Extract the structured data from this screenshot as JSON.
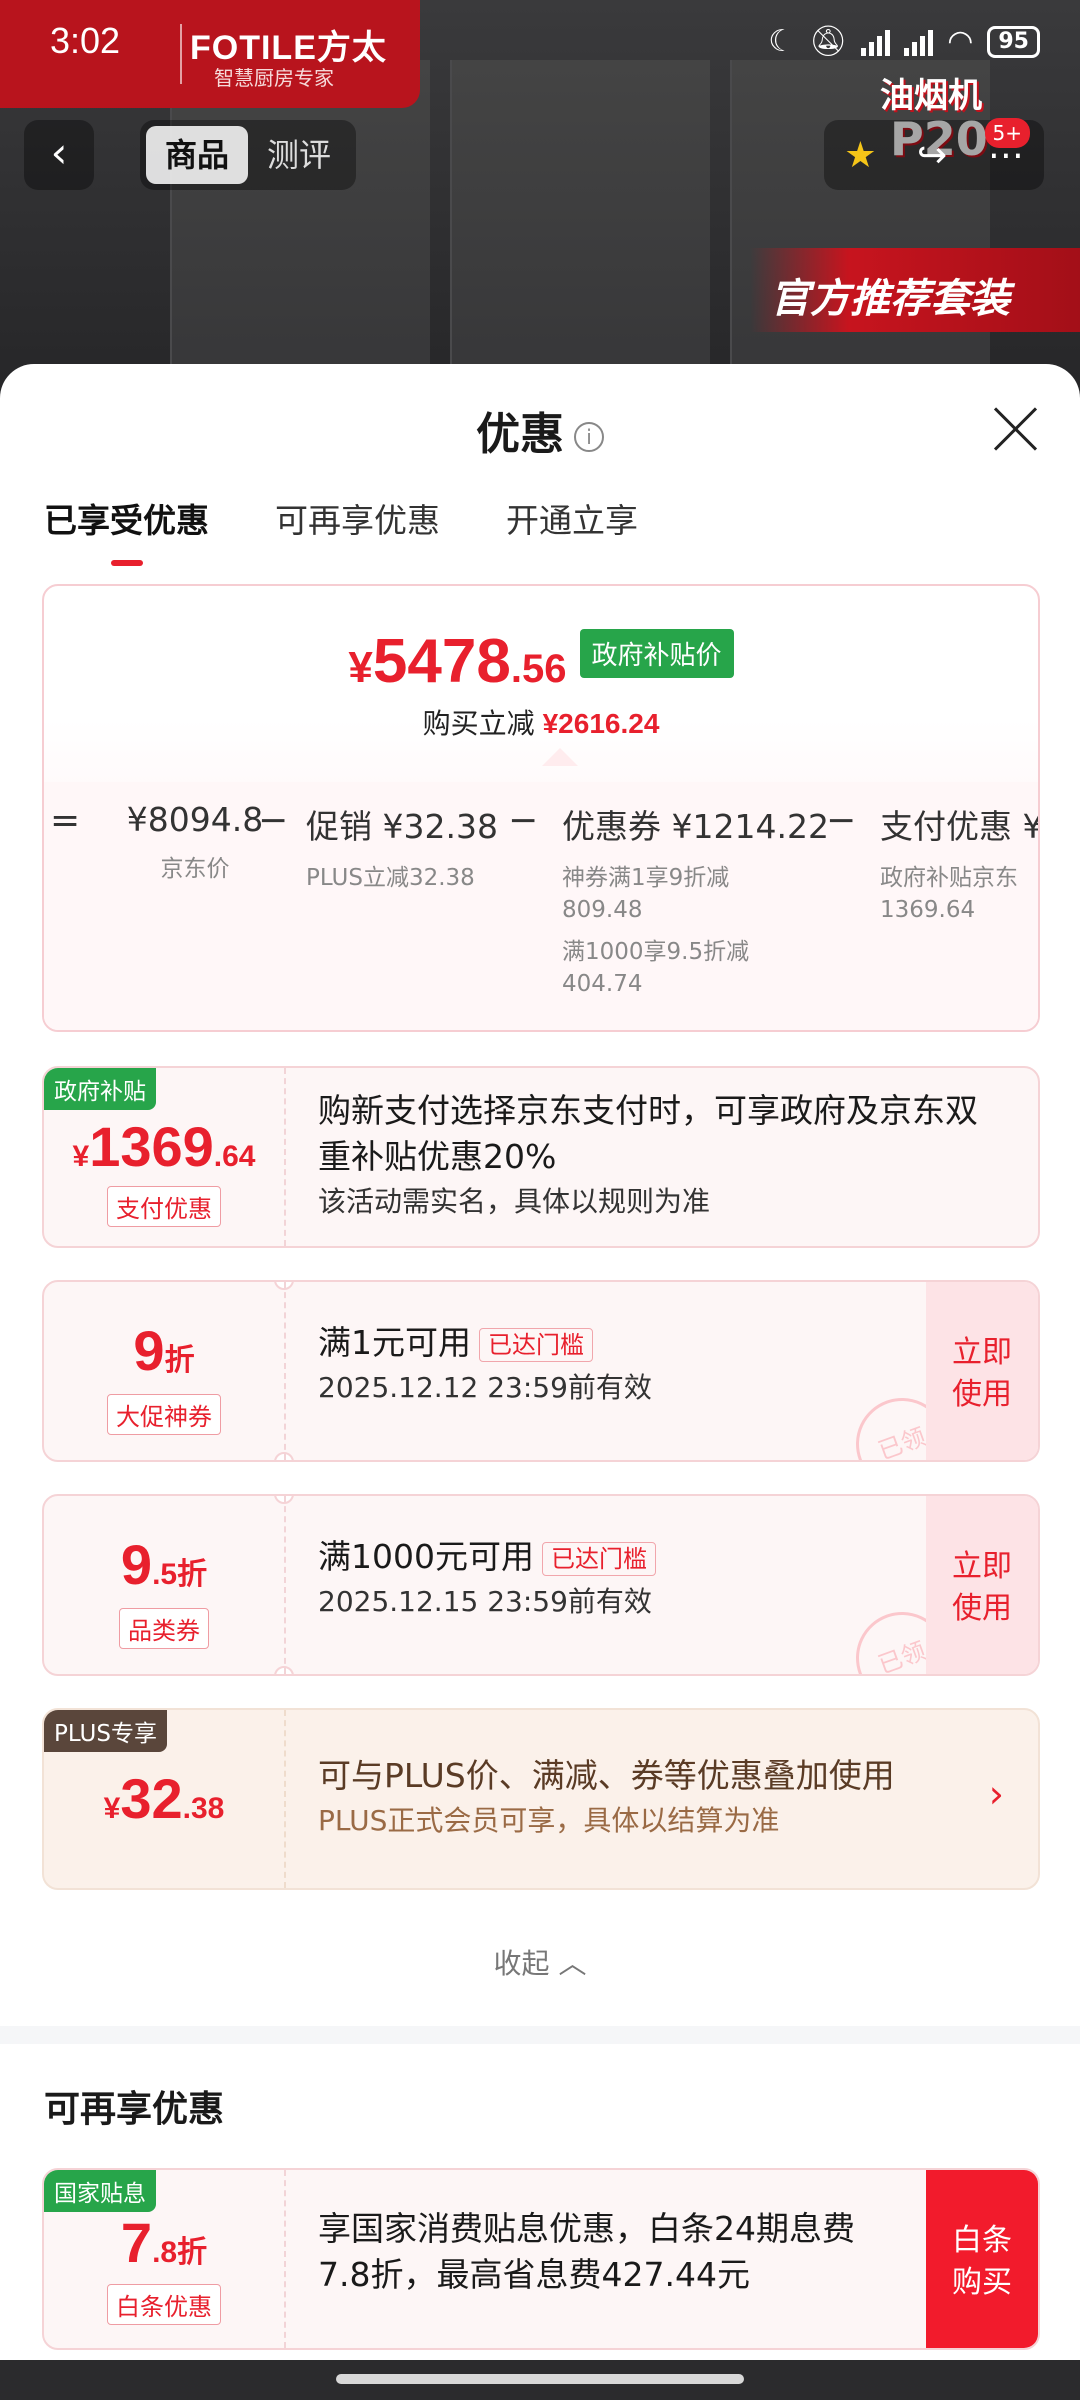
{
  "status": {
    "time": "3:02",
    "battery": "95"
  },
  "bg": {
    "brand": "FOTILE方太",
    "brand_sub": "智慧厨房专家",
    "promo_line1": "油烟机",
    "promo_line2": "P20",
    "recommend": "官方推荐套装",
    "badge": "5+"
  },
  "nav": {
    "tabs": [
      "商品",
      "测评"
    ]
  },
  "sheet": {
    "title": "优惠",
    "tabs": [
      "已享受优惠",
      "可再享优惠",
      "开通立享"
    ],
    "summary": {
      "price_currency": "¥",
      "price_int": "5478",
      "price_dec": ".56",
      "gov_tag": "政府补贴价",
      "save_label": "购买立减",
      "save_value": "¥2616.24",
      "formula": [
        {
          "op": "=",
          "main": "¥8094.8",
          "sub": [
            "京东价"
          ]
        },
        {
          "op": "−",
          "main": "促销 ¥32.38",
          "sub": [
            "PLUS立减32.38"
          ]
        },
        {
          "op": "−",
          "main": "优惠券 ¥1214.22",
          "sub": [
            "神券满1享9折减",
            "809.48",
            "满1000享9.5折减",
            "404.74"
          ]
        },
        {
          "op": "−",
          "main": "支付优惠 ¥",
          "sub": [
            "政府补贴京东",
            "1369.64"
          ]
        }
      ]
    },
    "cards": [
      {
        "corner": "政府补贴",
        "amount_cur": "¥",
        "amount_int": "1369",
        "amount_dec": ".64",
        "pill": "支付优惠",
        "line1": "购新支付选择京东支付时，可享政府及京东双重补贴优惠20%",
        "line2": "该活动需实名，具体以规则为准"
      },
      {
        "amount_int": "9",
        "amount_suffix": "折",
        "pill": "大促神券",
        "line1": "满1元可用",
        "reach": "已达门槛",
        "line2": "2025.12.12 23:59前有效",
        "button": [
          "立即",
          "使用"
        ],
        "stamp": "已领"
      },
      {
        "amount_int": "9",
        "amount_dec": ".5",
        "amount_suffix": "折",
        "pill": "品类券",
        "line1": "满1000元可用",
        "reach": "已达门槛",
        "line2": "2025.12.15 23:59前有效",
        "button": [
          "立即",
          "使用"
        ],
        "stamp": "已领"
      },
      {
        "corner": "PLUS专享",
        "amount_cur": "¥",
        "amount_int": "32",
        "amount_dec": ".38",
        "line1": "可与PLUS价、满减、券等优惠叠加使用",
        "line2": "PLUS正式会员可享，具体以结算为准"
      }
    ],
    "collapse": "收起",
    "section2_title": "可再享优惠",
    "extra_card": {
      "corner": "国家贴息",
      "amount_int": "7",
      "amount_dec": ".8",
      "amount_suffix": "折",
      "pill": "白条优惠",
      "line1": "享国家消费贴息优惠，白条24期息费",
      "line2": "7.8折，最高省息费427.44元",
      "button": [
        "白条",
        "购买"
      ]
    }
  },
  "colors": {
    "accent": "#e8202d",
    "gov_green": "#27a54a",
    "plus_brown": "#5a463b"
  }
}
